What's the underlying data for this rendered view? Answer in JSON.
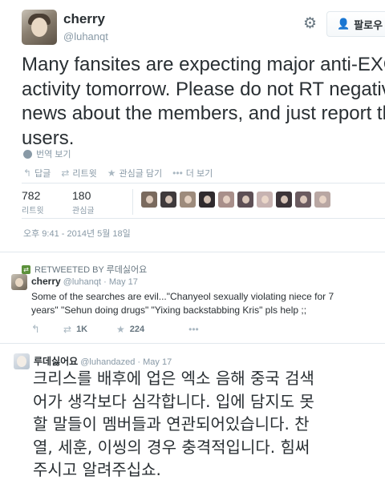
{
  "main_tweet": {
    "display_name": "cherry",
    "handle": "@luhanqt",
    "follow_label": "팔로우",
    "text_lines": [
      "Many fansites are expecting major anti-EXO",
      "activity tomorrow. Please do not RT negative",
      "news about the members, and just report the",
      "users."
    ],
    "translate_label": "번역 보기",
    "actions": {
      "reply": "답글",
      "retweet": "리트윗",
      "favorite": "관심글 담기",
      "more": "더 보기"
    },
    "stats": {
      "retweets_count": "782",
      "retweets_label": "리트윗",
      "favorites_count": "180",
      "favorites_label": "관심글"
    },
    "favoriter_avatar_colors": [
      "#7a6a5e",
      "#3f3a3c",
      "#9d8b7c",
      "#2f2a2d",
      "#a88f8a",
      "#5d4f55",
      "#c7b3b1",
      "#3c3438",
      "#6b5b60",
      "#b9a7a3"
    ],
    "timestamp": "오후 9:41 - 2014년 5월 18일"
  },
  "retweet_block": {
    "retweeted_by": "RETWEETED BY 루데싫어요",
    "display_name": "cherry",
    "handle": "@luhanqt",
    "date": "May 17",
    "text_lines": [
      "Some of the searches are evil...\"Chanyeol sexually violating niece for 7",
      "years\" \"Sehun doing drugs\" \"Yixing backstabbing Kris\" pls help ;;"
    ],
    "retweet_count": "1K",
    "favorite_count": "224"
  },
  "korean_tweet": {
    "display_name": "루데싫어요",
    "handle": "@luhandazed",
    "date": "May 17",
    "text_lines": [
      "크리스를 배후에 업은 엑소 음해 중국 검색",
      "어가 생각보다 심각합니다. 입에 담지도 못",
      "할 말들이 멤버들과 연관되어있습니다. 찬",
      "열, 세훈, 이씽의 경우 충격적입니다. 힘써",
      "주시고 알려주십쇼."
    ]
  }
}
